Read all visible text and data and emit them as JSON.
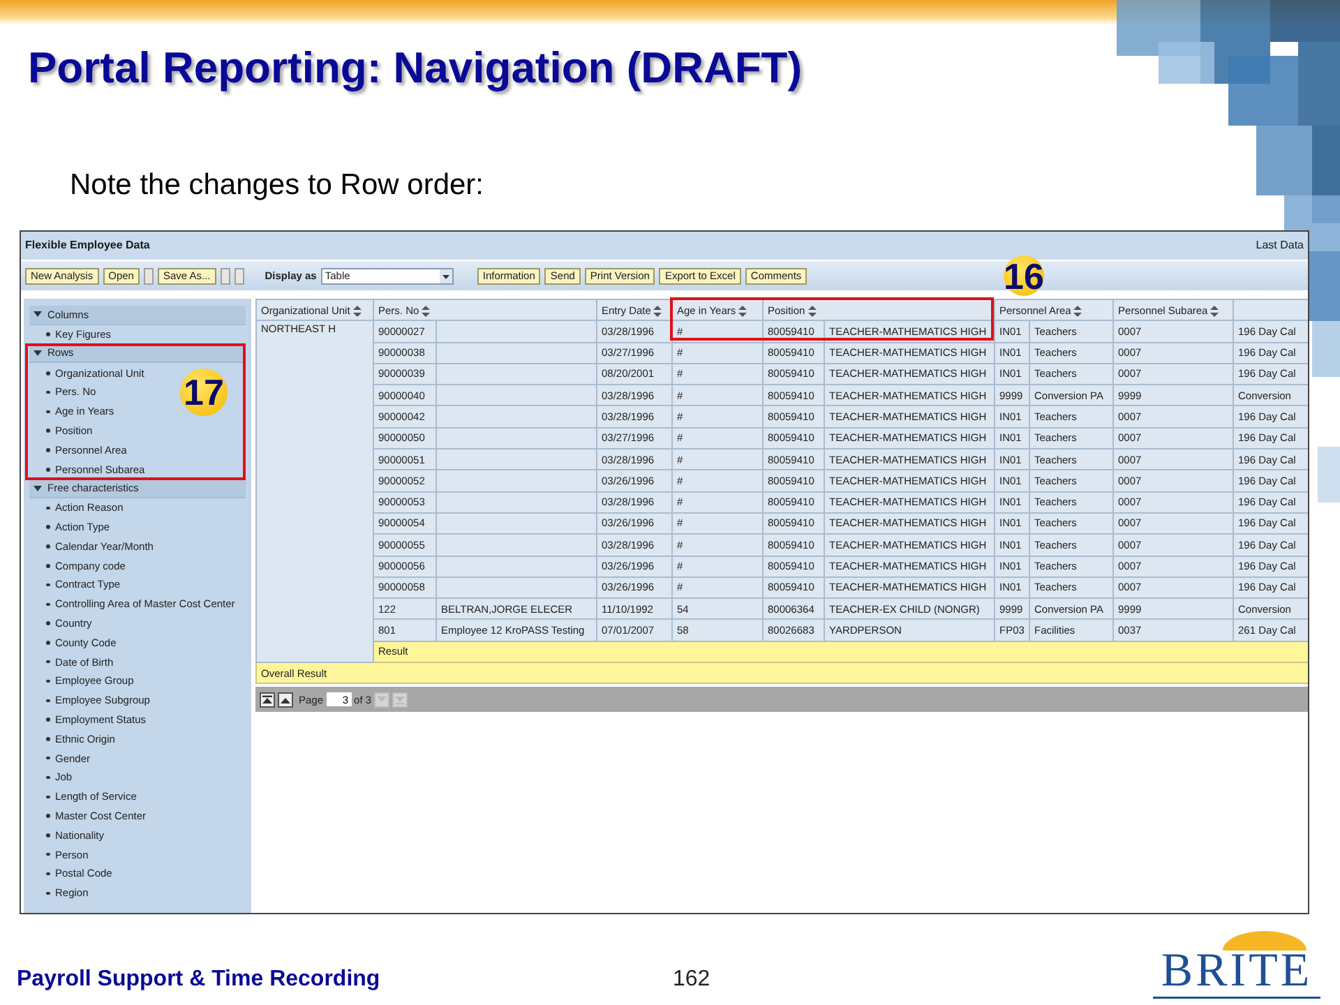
{
  "slide": {
    "title": "Portal Reporting: Navigation (DRAFT)",
    "subtitle": "Note the changes to Row order:",
    "footer": "Payroll Support & Time Recording",
    "page_number": "162",
    "logo": "BRITE"
  },
  "app": {
    "title": "Flexible Employee Data",
    "status": "Last Data",
    "toolbar": [
      {
        "kind": "button",
        "label": "New Analysis"
      },
      {
        "kind": "button",
        "label": "Open"
      },
      {
        "kind": "blank"
      },
      {
        "kind": "button",
        "label": "Save As..."
      },
      {
        "kind": "blank"
      },
      {
        "kind": "blank"
      }
    ],
    "display_as": {
      "label": "Display as",
      "value": "Table"
    },
    "actions": [
      "Information",
      "Send",
      "Print Version",
      "Export to Excel",
      "Comments"
    ],
    "sidebar": [
      {
        "label": "Columns",
        "expanded": true,
        "items": [
          "Key Figures"
        ]
      },
      {
        "label": "Rows",
        "expanded": true,
        "items": [
          "Organizational Unit",
          "Pers. No",
          "Age in Years",
          "Position",
          "Personnel Area",
          "Personnel Subarea"
        ]
      },
      {
        "label": "Free characteristics",
        "expanded": true,
        "items": [
          "Action Reason",
          "Action Type",
          "Calendar Year/Month",
          "Company code",
          "Contract Type",
          "Controlling Area of Master Cost Center",
          "Country",
          "County Code",
          "Date of Birth",
          "Employee Group",
          "Employee Subgroup",
          "Employment Status",
          "Ethnic Origin",
          "Gender",
          "Job",
          "Length of Service",
          "Master Cost Center",
          "Nationality",
          "Person",
          "Postal Code",
          "Region"
        ]
      }
    ],
    "callouts": [
      "17",
      "16"
    ],
    "table": {
      "columns": [
        "Organizational Unit",
        "Pers. No",
        "Entry Date",
        "Age in Years",
        "Position",
        "Personnel Area",
        "Personnel Subarea"
      ],
      "org_unit": "NORTHEAST H",
      "rows": [
        {
          "pers_no": "90000027",
          "entry_date": "03/28/1996",
          "age": "#",
          "position_code": "80059410",
          "position": "TEACHER-MATHEMATICS HIGH",
          "area_code": "IN01",
          "area": "Teachers",
          "subarea": "0007",
          "column_11": "196 Day Cal"
        },
        {
          "pers_no": "90000038",
          "entry_date": "03/27/1996",
          "age": "#",
          "position_code": "80059410",
          "position": "TEACHER-MATHEMATICS HIGH",
          "area_code": "IN01",
          "area": "Teachers",
          "subarea": "0007",
          "column_11": "196 Day Cal"
        },
        {
          "pers_no": "90000039",
          "entry_date": "08/20/2001",
          "age": "#",
          "position_code": "80059410",
          "position": "TEACHER-MATHEMATICS HIGH",
          "area_code": "IN01",
          "area": "Teachers",
          "subarea": "0007",
          "column_11": "196 Day Cal"
        },
        {
          "pers_no": "90000040",
          "entry_date": "03/28/1996",
          "age": "#",
          "position_code": "80059410",
          "position": "TEACHER-MATHEMATICS HIGH",
          "area_code": "9999",
          "area": "Conversion PA",
          "subarea": "9999",
          "column_11": "Conversion"
        },
        {
          "pers_no": "90000042",
          "entry_date": "03/28/1996",
          "age": "#",
          "position_code": "80059410",
          "position": "TEACHER-MATHEMATICS HIGH",
          "area_code": "IN01",
          "area": "Teachers",
          "subarea": "0007",
          "column_11": "196 Day Cal"
        },
        {
          "pers_no": "90000050",
          "entry_date": "03/27/1996",
          "age": "#",
          "position_code": "80059410",
          "position": "TEACHER-MATHEMATICS HIGH",
          "area_code": "IN01",
          "area": "Teachers",
          "subarea": "0007",
          "column_11": "196 Day Cal"
        },
        {
          "pers_no": "90000051",
          "entry_date": "03/28/1996",
          "age": "#",
          "position_code": "80059410",
          "position": "TEACHER-MATHEMATICS HIGH",
          "area_code": "IN01",
          "area": "Teachers",
          "subarea": "0007",
          "column_11": "196 Day Cal"
        },
        {
          "pers_no": "90000052",
          "entry_date": "03/26/1996",
          "age": "#",
          "position_code": "80059410",
          "position": "TEACHER-MATHEMATICS HIGH",
          "area_code": "IN01",
          "area": "Teachers",
          "subarea": "0007",
          "column_11": "196 Day Cal"
        },
        {
          "pers_no": "90000053",
          "entry_date": "03/28/1996",
          "age": "#",
          "position_code": "80059410",
          "position": "TEACHER-MATHEMATICS HIGH",
          "area_code": "IN01",
          "area": "Teachers",
          "subarea": "0007",
          "column_11": "196 Day Cal"
        },
        {
          "pers_no": "90000054",
          "entry_date": "03/26/1996",
          "age": "#",
          "position_code": "80059410",
          "position": "TEACHER-MATHEMATICS HIGH",
          "area_code": "IN01",
          "area": "Teachers",
          "subarea": "0007",
          "column_11": "196 Day Cal"
        },
        {
          "pers_no": "90000055",
          "entry_date": "03/28/1996",
          "age": "#",
          "position_code": "80059410",
          "position": "TEACHER-MATHEMATICS HIGH",
          "area_code": "IN01",
          "area": "Teachers",
          "subarea": "0007",
          "column_11": "196 Day Cal"
        },
        {
          "pers_no": "90000056",
          "entry_date": "03/26/1996",
          "age": "#",
          "position_code": "80059410",
          "position": "TEACHER-MATHEMATICS HIGH",
          "area_code": "IN01",
          "area": "Teachers",
          "subarea": "0007",
          "column_11": "196 Day Cal"
        },
        {
          "pers_no": "90000058",
          "entry_date": "03/26/1996",
          "age": "#",
          "position_code": "80059410",
          "position": "TEACHER-MATHEMATICS HIGH",
          "area_code": "IN01",
          "area": "Teachers",
          "subarea": "0007",
          "column_11": "196 Day Cal"
        },
        {
          "pers_no": "122",
          "name": "BELTRAN,JORGE ELECER",
          "entry_date": "11/10/1992",
          "age": "54",
          "position_code": "80006364",
          "position": "TEACHER-EX CHILD (NONGR)",
          "area_code": "9999",
          "area": "Conversion PA",
          "subarea": "9999",
          "column_11": "Conversion"
        },
        {
          "pers_no": "801",
          "name": "Employee 12 KroPASS Testing",
          "entry_date": "07/01/2007",
          "age": "58",
          "position_code": "80026683",
          "position": "YARDPERSON",
          "area_code": "FP03",
          "area": "Facilities",
          "subarea": "0037",
          "column_11": "261  Day Cal"
        }
      ],
      "result": "Result",
      "overall_result": "Overall Result"
    },
    "pager": {
      "label": "Page",
      "value": "3",
      "total": "of 3",
      "buttons": [
        {
          "kind": "first",
          "disabled": false
        },
        {
          "kind": "prev",
          "disabled": false
        },
        {
          "kind": "next",
          "disabled": true
        },
        {
          "kind": "last",
          "disabled": true
        }
      ]
    }
  }
}
